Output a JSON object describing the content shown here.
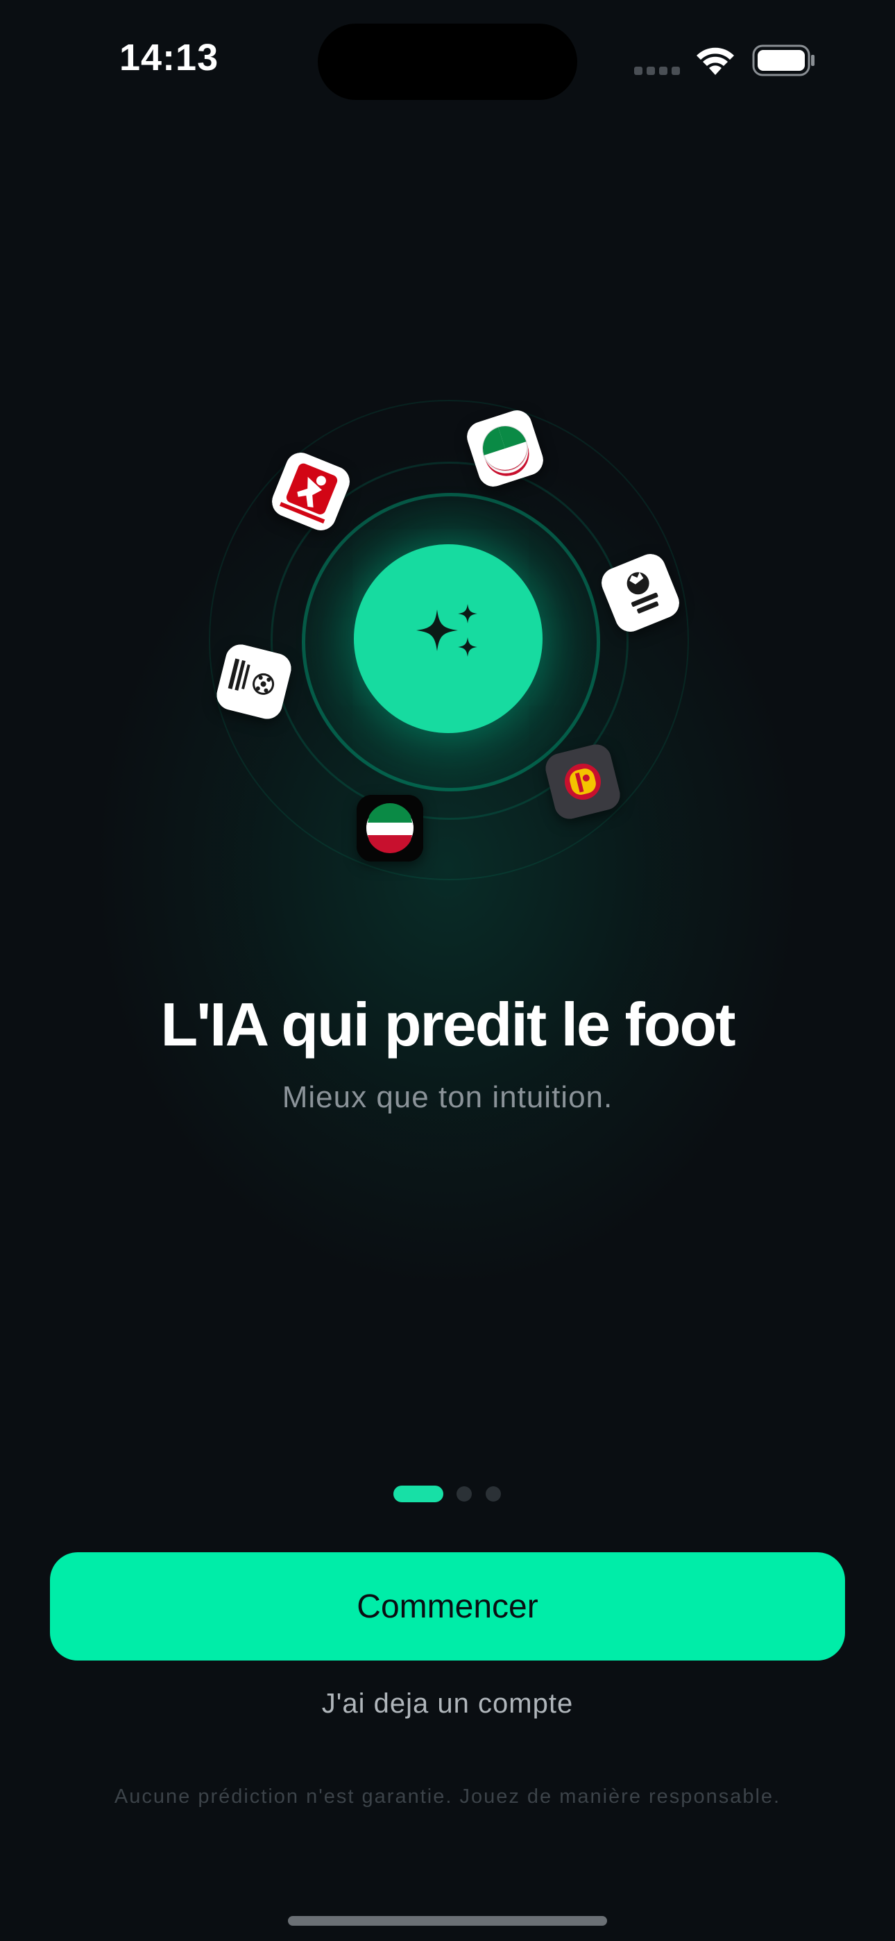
{
  "status_bar": {
    "time": "14:13",
    "icons": [
      "cellular-signal-icon",
      "wifi-icon",
      "battery-icon"
    ]
  },
  "hero": {
    "center_icon": "sparkles-icon",
    "league_badges": [
      {
        "name": "Bundesliga",
        "icon": "bundesliga-icon"
      },
      {
        "name": "Serie A",
        "icon": "serie-a-icon"
      },
      {
        "name": "Premier League",
        "icon": "premier-league-icon"
      },
      {
        "name": "Champions League",
        "icon": "champions-league-icon"
      },
      {
        "name": "La Liga",
        "icon": "la-liga-icon"
      },
      {
        "name": "Ligue",
        "icon": "league-flag-icon"
      }
    ]
  },
  "content": {
    "title": "L'IA qui predit le foot",
    "subtitle": "Mieux que ton intuition."
  },
  "pager": {
    "total": 3,
    "current": 1
  },
  "actions": {
    "primary_label": "Commencer",
    "secondary_label": "J'ai deja un compte"
  },
  "footer": {
    "disclaimer": "Aucune prédiction n'est garantie. Jouez de manière responsable."
  },
  "colors": {
    "background": "#0a0e12",
    "accent": "#00eda8",
    "muted_text": "#8b9399"
  }
}
